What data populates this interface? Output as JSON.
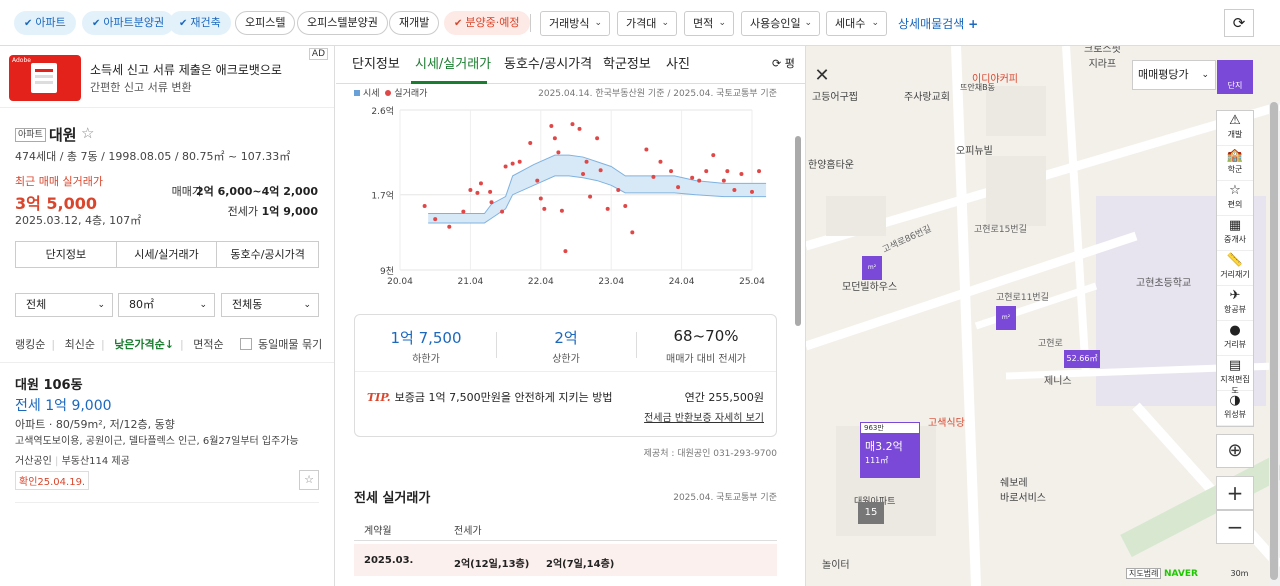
{
  "topbar": {
    "filters": [
      {
        "label": "아파트",
        "selected": true
      },
      {
        "label": "아파트분양권",
        "selected": true
      },
      {
        "label": "재건축",
        "selected": true
      },
      {
        "label": "오피스텔",
        "selected": false
      },
      {
        "label": "오피스텔분양권",
        "selected": false
      },
      {
        "label": "재개발",
        "selected": false
      },
      {
        "label": "분양중·예정",
        "selected": true
      }
    ],
    "dropdowns": [
      "거래방식",
      "가격대",
      "면적",
      "사용승인일",
      "세대수"
    ],
    "detail_search": "상세매물검색",
    "detail_plus": "+",
    "refresh": "⟳"
  },
  "ad": {
    "title": "소득세 신고 서류 제출은 애크로뱃으로",
    "subtitle": "간편한 신고 서류 변환",
    "badge": "AD",
    "brand": "Adobe"
  },
  "complex": {
    "type": "아파트",
    "name": "대원",
    "star": "☆",
    "info": "474세대 / 총 7동 / 1998.08.05 / 80.75㎡ ~ 107.33㎡",
    "recent_label": "최근 매매 실거래가",
    "recent_price": "3억 5,000",
    "recent_date": "2025.03.12, 4층, 107㎡",
    "sale_label": "매매가",
    "sale_range": "2억 6,000~4억 2,000",
    "lease_label": "전세가",
    "lease_value": "1억 9,000",
    "tabs": [
      "단지정보",
      "시세/실거래가",
      "동호수/공시가격"
    ]
  },
  "listfilter": {
    "selects": [
      "전체",
      "80㎡",
      "전체동"
    ],
    "sorts": [
      "랭킹순",
      "최신순",
      "낮은가격순↓",
      "면적순"
    ],
    "active_sort": "낮은가격순↓",
    "same_listing": "동일매물 묶기"
  },
  "listing": {
    "name": "대원 106동",
    "price": "전세 1억 9,000",
    "sub": "아파트 · 80/59m², 저/12층, 동향",
    "desc": "고색역도보이용, 공원이근, 델타플렉스 인근, 6월27일부터 입주가능",
    "agent": "거산공인",
    "agent_source": "부동산114 제공",
    "confirm": "확인25.04.19.",
    "bookmark": "☆"
  },
  "detail": {
    "tabs": [
      "단지정보",
      "시세/실거래가",
      "동호수/공시가격",
      "학군정보",
      "사진"
    ],
    "active_tab": "시세/실거래가",
    "more": "⟳ 평",
    "legend": [
      "시세",
      "실거래가"
    ],
    "source": "2025.04.14. 한국부동산원 기준 / 2025.04. 국토교통부 기준",
    "stats": [
      {
        "value": "1억 7,500",
        "label": "하한가"
      },
      {
        "value": "2억",
        "label": "상한가"
      },
      {
        "value": "68~70%",
        "label": "매매가 대비 전세가"
      }
    ],
    "tip_mark": "TIP.",
    "tip_text": "보증금 1억 7,500만원을 안전하게 지키는 방법",
    "tip_fee_label": "연간",
    "tip_fee": "255,500원",
    "tip_link": "전세금 반환보증 자세히 보기",
    "provider": "제공처 : 대원공인 031-293-9700",
    "section_title": "전세 실거래가",
    "section_source": "2025.04. 국토교통부 기준",
    "table_headers": [
      "계약월",
      "전세가"
    ],
    "rows": [
      {
        "month": "2025.03.",
        "v1": "2억(12일,13층)",
        "v2": "2억(7일,14층)"
      }
    ],
    "close": "✕"
  },
  "chart_data": {
    "type": "scatter",
    "xlabel": "",
    "ylabel": "",
    "x_ticks": [
      "20.04",
      "21.04",
      "22.04",
      "23.04",
      "24.04",
      "25.04"
    ],
    "y_ticks": [
      "2.6억",
      "1.7억",
      "9천"
    ],
    "ylim": [
      0.9,
      2.6
    ],
    "series": [
      {
        "name": "실거래가",
        "points": [
          [
            2020.35,
            1.58
          ],
          [
            2020.5,
            1.44
          ],
          [
            2020.7,
            1.36
          ],
          [
            2020.9,
            1.52
          ],
          [
            2021.0,
            1.75
          ],
          [
            2021.1,
            1.72
          ],
          [
            2021.15,
            1.82
          ],
          [
            2021.28,
            1.73
          ],
          [
            2021.3,
            1.62
          ],
          [
            2021.45,
            1.52
          ],
          [
            2021.5,
            2.0
          ],
          [
            2021.6,
            2.03
          ],
          [
            2021.7,
            2.05
          ],
          [
            2021.85,
            2.25
          ],
          [
            2021.95,
            1.85
          ],
          [
            2022.0,
            1.66
          ],
          [
            2022.05,
            1.55
          ],
          [
            2022.15,
            2.43
          ],
          [
            2022.2,
            2.3
          ],
          [
            2022.25,
            2.15
          ],
          [
            2022.3,
            1.53
          ],
          [
            2022.35,
            1.1
          ],
          [
            2022.45,
            2.45
          ],
          [
            2022.55,
            2.4
          ],
          [
            2022.6,
            1.92
          ],
          [
            2022.65,
            2.05
          ],
          [
            2022.7,
            1.68
          ],
          [
            2022.8,
            2.3
          ],
          [
            2022.85,
            1.96
          ],
          [
            2022.95,
            1.55
          ],
          [
            2023.1,
            1.75
          ],
          [
            2023.2,
            1.58
          ],
          [
            2023.3,
            1.3
          ],
          [
            2023.5,
            2.18
          ],
          [
            2023.6,
            1.89
          ],
          [
            2023.7,
            2.05
          ],
          [
            2023.85,
            1.95
          ],
          [
            2023.95,
            1.78
          ],
          [
            2024.15,
            1.88
          ],
          [
            2024.25,
            1.85
          ],
          [
            2024.35,
            1.95
          ],
          [
            2024.45,
            2.12
          ],
          [
            2024.6,
            1.85
          ],
          [
            2024.65,
            1.95
          ],
          [
            2024.75,
            1.75
          ],
          [
            2024.85,
            1.92
          ],
          [
            2025.0,
            1.73
          ],
          [
            2025.1,
            1.95
          ]
        ]
      },
      {
        "name": "시세",
        "band": [
          [
            2020.4,
            1.5,
            1.4
          ],
          [
            2021.2,
            1.5,
            1.4
          ],
          [
            2021.3,
            1.6,
            1.45
          ],
          [
            2021.5,
            1.68,
            1.55
          ],
          [
            2021.6,
            1.9,
            1.7
          ],
          [
            2021.9,
            2.02,
            1.8
          ],
          [
            2022.2,
            2.12,
            1.9
          ],
          [
            2022.4,
            2.12,
            1.9
          ],
          [
            2022.6,
            2.1,
            1.88
          ],
          [
            2022.8,
            2.05,
            1.85
          ],
          [
            2023.0,
            2.0,
            1.8
          ],
          [
            2023.2,
            1.9,
            1.72
          ],
          [
            2023.5,
            1.9,
            1.72
          ],
          [
            2023.9,
            1.9,
            1.72
          ],
          [
            2024.2,
            1.85,
            1.7
          ],
          [
            2024.6,
            1.82,
            1.68
          ],
          [
            2025.2,
            1.82,
            1.68
          ]
        ]
      }
    ]
  },
  "map": {
    "labels": [
      {
        "t": "크로스핏\n지라프"
      },
      {
        "t": "이디야커피"
      },
      {
        "t": "고등어구찝"
      },
      {
        "t": "주사랑교회"
      },
      {
        "t": "뜨안채B동"
      },
      {
        "t": "오피뉴빌"
      },
      {
        "t": "한양홈타운"
      },
      {
        "t": "모던빌하우스"
      },
      {
        "t": "고현초등학교"
      },
      {
        "t": "제니스"
      },
      {
        "t": "고색식당"
      },
      {
        "t": "쉐보레\n바로서비스"
      },
      {
        "t": "대원아파트"
      },
      {
        "t": "놀이터"
      }
    ],
    "roads": [
      "고색로86번길",
      "고현로15번길",
      "고현로11번길",
      "고현로"
    ],
    "price_select": "매매평당가",
    "danji": "단지",
    "controls": [
      {
        "icon": "⚠",
        "label": "개발"
      },
      {
        "icon": "🏫",
        "label": "학군"
      },
      {
        "icon": "☆",
        "label": "편의"
      },
      {
        "icon": "▦",
        "label": "중개사"
      },
      {
        "icon": "📏",
        "label": "거리재기"
      },
      {
        "icon": "✈",
        "label": "항공뷰"
      },
      {
        "icon": "●",
        "label": "거리뷰"
      },
      {
        "icon": "▤",
        "label": "지적편집도"
      },
      {
        "icon": "◑",
        "label": "위성뷰"
      }
    ],
    "zoom_in": "+",
    "zoom_out": "−",
    "locate": "⊕",
    "callout": {
      "top": "963만",
      "price": "매3.2억",
      "area": "111㎡"
    },
    "count": "15",
    "tag52": "52.66㎡",
    "map_ctrl": "지도범례",
    "naver": "NAVER",
    "scale": "30m"
  }
}
